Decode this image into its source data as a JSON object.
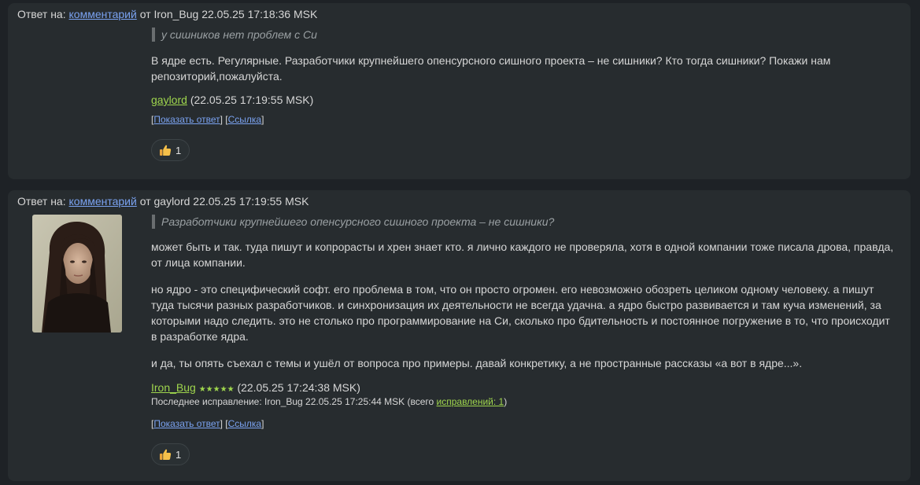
{
  "comments": [
    {
      "reply_prefix": "Ответ на:",
      "reply_link": "комментарий",
      "reply_suffix": "от Iron_Bug 22.05.25 17:18:36 MSK",
      "quote": "у сишников нет проблем с Си",
      "paragraphs": [
        "В ядре есть. Регулярные. Разработчики крупнейшего опенсурсного сишного проекта – не сишники? Кто тогда сишники? Покажи нам репозиторий,пожалуйста."
      ],
      "author": "gaylord",
      "author_date": "(22.05.25 17:19:55 MSK)",
      "actions": {
        "open_bracket": "[",
        "show_reply": "Показать ответ",
        "separator": "] [",
        "link": "Ссылка",
        "close_bracket": "]"
      },
      "reaction_count": "1"
    },
    {
      "reply_prefix": "Ответ на:",
      "reply_link": "комментарий",
      "reply_suffix": "от gaylord 22.05.25 17:19:55 MSK",
      "quote": "Разработчики крупнейшего опенсурсного сишного проекта – не сишники?",
      "paragraphs": [
        "может быть и так. туда пишут и копрорасты и хрен знает кто. я лично каждого не проверяла, хотя в одной компании тоже писала дрова, правда, от лица компании.",
        "но ядро - это специфический софт. его проблема в том, что он просто огромен. его невозможно обозреть целиком одному человеку. а пишут туда тысячи разных разработчиков. и синхронизация их деятельности не всегда удачна. а ядро быстро развивается и там куча изменений, за которыми надо следить. это не столько про программирование на Си, сколько про бдительность и постоянное погружение в то, что происходит в разработке ядра.",
        "и да, ты опять съехал с темы и ушёл от вопроса про примеры. давай конкретику, а не пространные рассказы «а вот в ядре...»."
      ],
      "author": "Iron_Bug",
      "author_stars": "★★★★★",
      "author_date": "(22.05.25 17:24:38 MSK)",
      "edit_prefix": "Последнее исправление: Iron_Bug 22.05.25 17:25:44 MSK (всего",
      "edit_link": "исправлений: 1",
      "edit_suffix": ")",
      "actions": {
        "open_bracket": "[",
        "show_reply": "Показать ответ",
        "separator": "] [",
        "link": "Ссылка",
        "close_bracket": "]"
      },
      "reaction_count": "1"
    }
  ],
  "icons": {
    "reaction": "thumbs-up-icon",
    "avatar": "user-avatar-photo"
  },
  "colors": {
    "page_bg": "#1e2226",
    "card_bg": "#272c2f",
    "link_blue": "#7aa2f0",
    "link_green": "#9fd64d",
    "quote_text": "#9aa0a3"
  }
}
